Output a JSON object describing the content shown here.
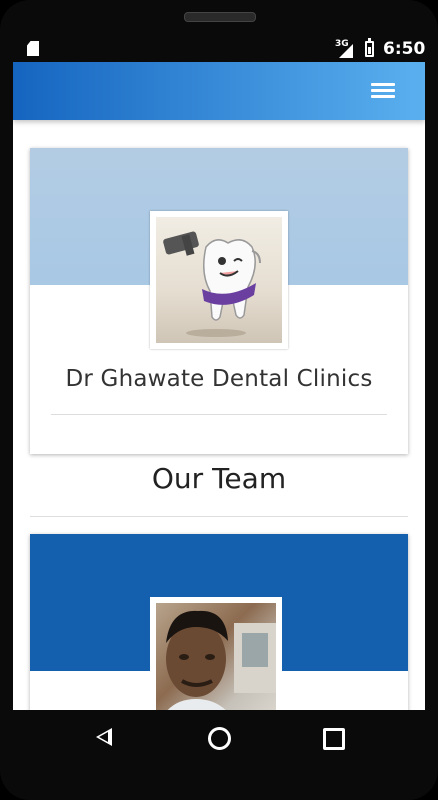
{
  "status_bar": {
    "network": "3G",
    "time": "6:50",
    "icons": [
      "sd-card-icon",
      "signal-icon",
      "battery-icon"
    ]
  },
  "app_bar": {
    "menu_icon": "hamburger-menu-icon",
    "gradient_start": "#1565c0",
    "gradient_end": "#5ab0ef"
  },
  "clinic_card": {
    "name": "Dr Ghawate Dental Clinics",
    "logo_icon": "tooth-mascot-icon",
    "header_color": "#b3cce4"
  },
  "team_section": {
    "title": "Our Team"
  },
  "team_card": {
    "photo_icon": "team-member-photo",
    "header_color": "#1560ae"
  },
  "nav_bar": {
    "icons": [
      "back-icon",
      "home-icon",
      "recent-apps-icon"
    ]
  }
}
